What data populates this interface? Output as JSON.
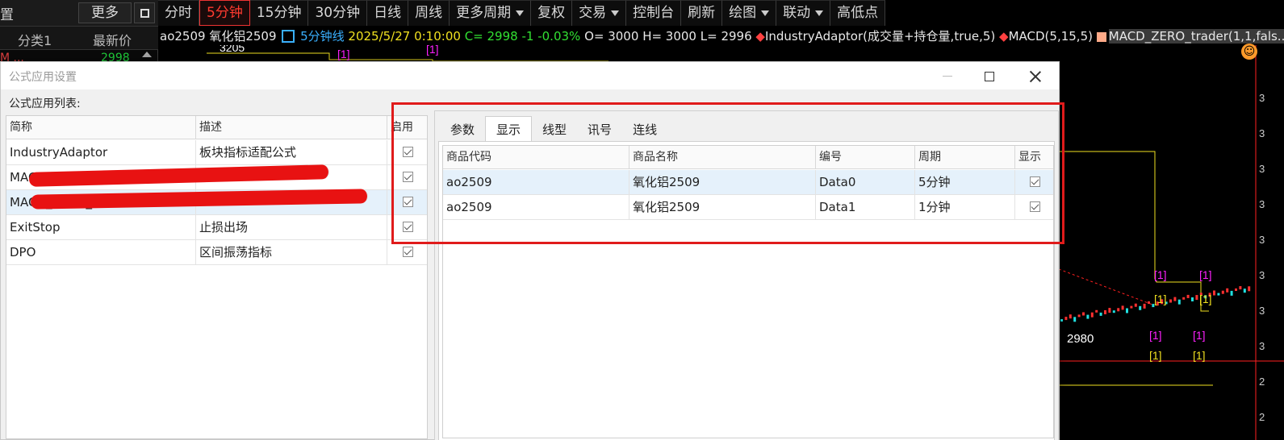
{
  "left_panel": {
    "title": "置",
    "more_label": "更多",
    "col_category": "分类1",
    "col_price": "最新价",
    "row_name": "M  ...",
    "row_price": "2998"
  },
  "toolbar": {
    "items": [
      {
        "label": "分时"
      },
      {
        "label": "5分钟",
        "active": true
      },
      {
        "label": "15分钟"
      },
      {
        "label": "30分钟"
      },
      {
        "label": "日线"
      },
      {
        "label": "周线"
      },
      {
        "label": "更多周期",
        "dropdown": true
      },
      {
        "label": "复权"
      },
      {
        "label": "交易",
        "dropdown": true
      },
      {
        "label": "控制台"
      },
      {
        "label": "刷新"
      },
      {
        "label": "绘图",
        "dropdown": true
      },
      {
        "label": "联动",
        "dropdown": true
      },
      {
        "label": "高低点"
      }
    ]
  },
  "info": {
    "code": "ao2509",
    "name": "氧化铝2509",
    "period": "5分钟线",
    "datetime": "2025/5/27 0:10:00",
    "close": "C= 2998",
    "change": "-1",
    "change_pct": "-0.03%",
    "open": "O= 3000",
    "high": "H= 3000",
    "low": "L= 2996",
    "indicator1": "IndustryAdaptor(成交量+持仓量,true,5)",
    "indicator2": "MACD(5,15,5)",
    "indicator3": "MACD_ZERO_trader(1,1,fals..."
  },
  "chart": {
    "label_high": "3205",
    "label_low": "2980",
    "signal_label": "[1]",
    "right_ticks": [
      "3",
      "3",
      "3",
      "3",
      "3",
      "3",
      "3",
      "3",
      "2",
      "2"
    ],
    "colors": {
      "up": "#ff3030",
      "down": "#20e0e0",
      "signal": "#ff20ff",
      "line": "#f0e020"
    }
  },
  "dialog": {
    "title": "公式应用设置",
    "list_label": "公式应用列表:",
    "list_columns": [
      "简称",
      "描述",
      "启用"
    ],
    "list_rows": [
      {
        "name": "IndustryAdaptor",
        "desc": "板块指标适配公式",
        "enabled": true
      },
      {
        "name": "MACD",
        "desc": "",
        "enabled": true,
        "redacted": true
      },
      {
        "name": "MACD_ZERO_trader",
        "desc": "",
        "enabled": true,
        "redacted": true,
        "selected": true
      },
      {
        "name": "ExitStop",
        "desc": "止损出场",
        "enabled": true
      },
      {
        "name": "DPO",
        "desc": "区间振荡指标",
        "enabled": true
      }
    ],
    "tabs": [
      {
        "label": "参数"
      },
      {
        "label": "显示",
        "active": true
      },
      {
        "label": "线型"
      },
      {
        "label": "讯号"
      },
      {
        "label": "连线"
      }
    ],
    "display_columns": [
      "商品代码",
      "商品名称",
      "编号",
      "周期",
      "显示"
    ],
    "display_rows": [
      {
        "code": "ao2509",
        "name": "氧化铝2509",
        "id": "Data0",
        "period": "5分钟",
        "show": true
      },
      {
        "code": "ao2509",
        "name": "氧化铝2509",
        "id": "Data1",
        "period": "1分钟",
        "show": true
      }
    ]
  }
}
